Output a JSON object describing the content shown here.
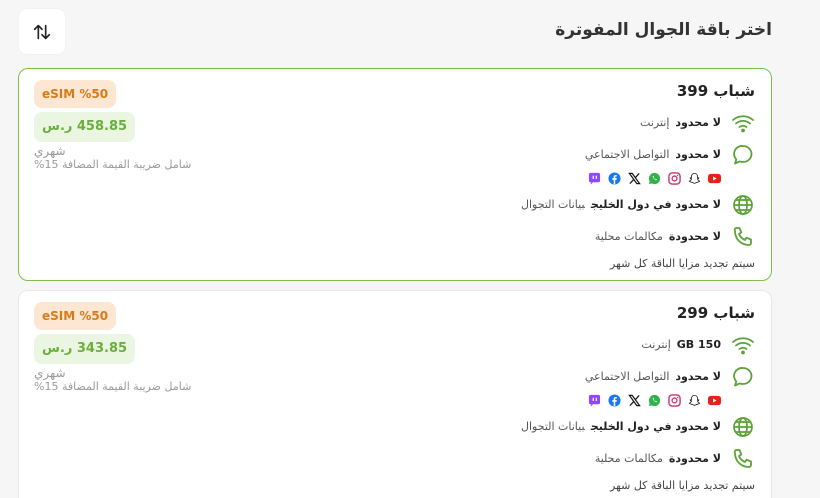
{
  "page": {
    "title": "اختر باقة الجوال المفوترة",
    "sort_icon": "sort-arrows-icon"
  },
  "colors": {
    "accent_green": "#7cc04a",
    "icon_green": "#5ba237",
    "esim_bg": "#fde7d2",
    "esim_text": "#d77a18",
    "price_bg": "#eaf6e2",
    "price_text": "#6aaf3c"
  },
  "plans": [
    {
      "name": "شباب 399",
      "selected": true,
      "esim_badge": "eSIM %50",
      "price": "458.85 ر.س",
      "period": "شهري",
      "vat_note": "شامل ضريبة القيمة المضافة 15%",
      "features": {
        "internet": {
          "icon": "wifi-icon",
          "value": "لا محدود",
          "label": "إنترنت"
        },
        "social": {
          "icon": "chat-bubble-icon",
          "value": "لا محدود",
          "label": "التواصل الاجتماعي",
          "apps": [
            "youtube-icon",
            "snapchat-icon",
            "instagram-icon",
            "whatsapp-icon",
            "x-icon",
            "facebook-icon",
            "twitch-icon"
          ]
        },
        "roaming": {
          "icon": "globe-icon",
          "value": "لا محدود في دول الخليج",
          "label": "بيانات التجوال"
        },
        "calls": {
          "icon": "phone-icon",
          "value": "لا محدودة",
          "label": "مكالمات محلية"
        }
      },
      "renew_note": "سيتم تجديد مزايا الباقة كل شهر"
    },
    {
      "name": "شباب 299",
      "selected": false,
      "esim_badge": "eSIM %50",
      "price": "343.85 ر.س",
      "period": "شهري",
      "vat_note": "شامل ضريبة القيمة المضافة 15%",
      "features": {
        "internet": {
          "icon": "wifi-icon",
          "value": "GB 150",
          "label": "إنترنت"
        },
        "social": {
          "icon": "chat-bubble-icon",
          "value": "لا محدود",
          "label": "التواصل الاجتماعي",
          "apps": [
            "youtube-icon",
            "snapchat-icon",
            "instagram-icon",
            "whatsapp-icon",
            "x-icon",
            "facebook-icon",
            "twitch-icon"
          ]
        },
        "roaming": {
          "icon": "globe-icon",
          "value": "لا محدود في دول الخليج",
          "label": "بيانات التجوال"
        },
        "calls": {
          "icon": "phone-icon",
          "value": "لا محدودة",
          "label": "مكالمات محلية"
        }
      },
      "renew_note": "سيتم تجديد مزايا الباقة كل شهر"
    }
  ]
}
